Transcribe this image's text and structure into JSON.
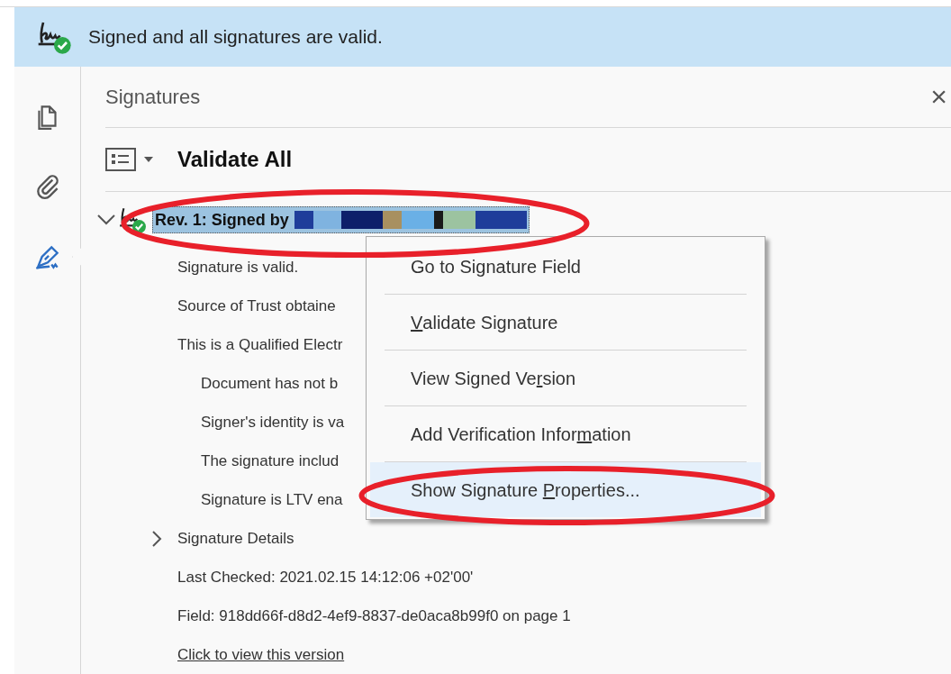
{
  "banner": {
    "text": "Signed and all signatures are valid."
  },
  "rail": [
    {
      "kind": "pages",
      "selected": false
    },
    {
      "kind": "attachments",
      "selected": false
    },
    {
      "kind": "signatures",
      "selected": true
    }
  ],
  "panel": {
    "title": "Signatures",
    "close": "×",
    "validate_all": "Validate All",
    "signature": {
      "label": "Rev. 1: Signed by",
      "expanded": true,
      "selected": true,
      "lines": [
        {
          "text": "Signature is valid.",
          "indent": false
        },
        {
          "text": "Source of Trust obtaine",
          "indent": false
        },
        {
          "text": "This is a Qualified Electr",
          "indent": false
        },
        {
          "text": "Document has not b",
          "indent": true
        },
        {
          "text": "Signer's identity is va",
          "indent": true
        },
        {
          "text": "The signature includ",
          "indent": true
        },
        {
          "text": "Signature is LTV ena",
          "indent": true
        }
      ],
      "details": {
        "label": "Signature Details",
        "expanded": false
      },
      "last_checked": "Last Checked: 2021.02.15 14:12:06 +02'00'",
      "field": "Field: 918dd66f-d8d2-4ef9-8837-de0aca8b99f0 on page 1",
      "link": "Click to view this version"
    }
  },
  "context_menu": [
    {
      "parts": [
        {
          "text": "Go to Signature Field",
          "underline": false
        }
      ],
      "selected": false
    },
    {
      "parts": [
        {
          "text": "V",
          "underline": true
        },
        {
          "text": "alidate Signature",
          "underline": false
        }
      ],
      "selected": false
    },
    {
      "parts": [
        {
          "text": "View Signed Ve",
          "underline": false
        },
        {
          "text": "r",
          "underline": true
        },
        {
          "text": "sion",
          "underline": false
        }
      ],
      "selected": false
    },
    {
      "parts": [
        {
          "text": "Add Verification Infor",
          "underline": false
        },
        {
          "text": "m",
          "underline": true
        },
        {
          "text": "ation",
          "underline": false
        }
      ],
      "selected": false
    },
    {
      "parts": [
        {
          "text": "Show Signature ",
          "underline": false
        },
        {
          "text": "P",
          "underline": true
        },
        {
          "text": "roperties...",
          "underline": false
        }
      ],
      "selected": true
    }
  ]
}
